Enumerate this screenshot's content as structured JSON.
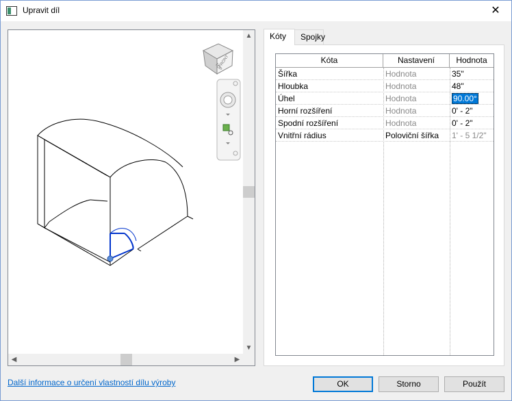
{
  "window": {
    "title": "Upravit díl",
    "close_glyph": "✕"
  },
  "tabs": [
    {
      "label": "Kóty",
      "active": true
    },
    {
      "label": "Spojky",
      "active": false
    }
  ],
  "grid": {
    "columns": [
      "Kóta",
      "Nastavení",
      "Hodnota"
    ],
    "rows": [
      {
        "name": "Šířka",
        "setting": "Hodnota",
        "value": "35\""
      },
      {
        "name": "Hloubka",
        "setting": "Hodnota",
        "value": "48\""
      },
      {
        "name": "Úhel",
        "setting": "Hodnota",
        "value": "90.00°",
        "selected": true
      },
      {
        "name": "Horní rozšíření",
        "setting": "Hodnota",
        "value": "0' - 2\""
      },
      {
        "name": "Spodní rozšíření",
        "setting": "Hodnota",
        "value": "0' - 2\""
      },
      {
        "name": "Vnitřní rádius",
        "setting": "Poloviční šířka",
        "value": "1' - 5 1/2\"",
        "value_disabled": true
      }
    ]
  },
  "viewcube": {
    "faces": [
      "TOP",
      "FRONT"
    ]
  },
  "footer": {
    "help_link": "Další informace o určení vlastností dílu výroby",
    "ok_label": "OK",
    "cancel_label": "Storno",
    "apply_label": "Použít"
  },
  "colors": {
    "accent": "#0078d7",
    "selection_blue": "#0033cc",
    "link": "#0066cc"
  }
}
